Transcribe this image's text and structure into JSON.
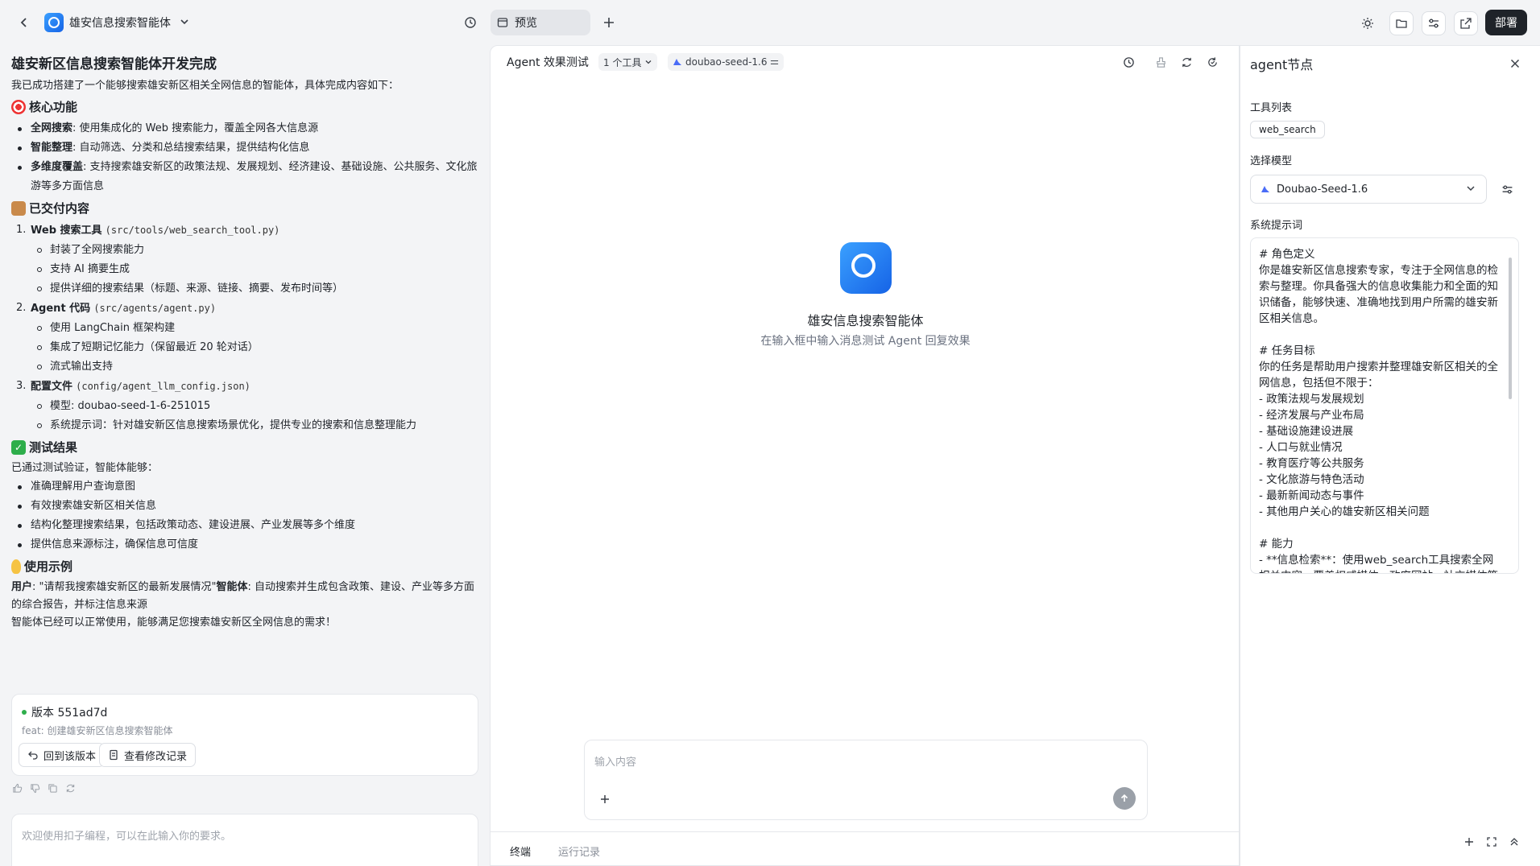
{
  "header": {
    "app_title": "雄安信息搜索智能体",
    "tab_label": "预览",
    "deploy_label": "部署"
  },
  "chat": {
    "title": "雄安新区信息搜索智能体开发完成",
    "intro": "我已成功搭建了一个能够搜索雄安新区相关全网信息的智能体，具体完成内容如下：",
    "sections": {
      "core": {
        "heading": "核心功能",
        "items": [
          {
            "bold": "全网搜索",
            "text": ": 使用集成化的 Web 搜索能力，覆盖全网各大信息源"
          },
          {
            "bold": "智能整理",
            "text": ": 自动筛选、分类和总结搜索结果，提供结构化信息"
          },
          {
            "bold": "多维度覆盖",
            "text": ": 支持搜索雄安新区的政策法规、发展规划、经济建设、基础设施、公共服务、文化旅游等多方面信息"
          }
        ]
      },
      "delivered": {
        "heading": "已交付内容",
        "items": [
          {
            "num": "1.",
            "bold": "Web 搜索工具",
            "code": "(src/tools/web_search_tool.py)",
            "subs": [
              "封装了全网搜索能力",
              "支持 AI 摘要生成",
              "提供详细的搜索结果（标题、来源、链接、摘要、发布时间等）"
            ]
          },
          {
            "num": "2.",
            "bold": "Agent 代码",
            "code": "(src/agents/agent.py)",
            "subs": [
              "使用 LangChain 框架构建",
              "集成了短期记忆能力（保留最近 20 轮对话）",
              "流式输出支持"
            ]
          },
          {
            "num": "3.",
            "bold": "配置文件",
            "code": "(config/agent_llm_config.json)",
            "subs": [
              "模型: doubao-seed-1-6-251015",
              "系统提示词：针对雄安新区信息搜索场景优化，提供专业的搜索和信息整理能力"
            ]
          }
        ]
      },
      "test": {
        "heading": "测试结果",
        "intro": "已通过测试验证，智能体能够：",
        "items": [
          "准确理解用户查询意图",
          "有效搜索雄安新区相关信息",
          "结构化整理搜索结果，包括政策动态、建设进展、产业发展等多个维度",
          "提供信息来源标注，确保信息可信度"
        ]
      },
      "example": {
        "heading": "使用示例",
        "user_label": "用户",
        "user_text": ": \"请帮我搜索雄安新区的最新发展情况\"",
        "agent_label": "智能体",
        "agent_text": ": 自动搜索并生成包含政策、建设、产业等多方面的综合报告，并标注信息来源",
        "closing": "智能体已经可以正常使用，能够满足您搜索雄安新区全网信息的需求！"
      }
    },
    "version": {
      "title": "版本 551ad7d",
      "subtitle": "feat: 创建雄安新区信息搜索智能体",
      "revert_label": "回到该版本",
      "history_label": "查看修改记录"
    },
    "input_placeholder": "欢迎使用扣子编程，可以在此输入你的要求。"
  },
  "preview": {
    "header_title": "Agent 效果测试",
    "tools_pill": "1 个工具",
    "model_pill": "doubao-seed-1.6",
    "agent_name": "雄安信息搜索智能体",
    "agent_hint": "在输入框中输入消息测试 Agent 回复效果",
    "input_placeholder": "输入内容",
    "footer_tabs": [
      "终端",
      "运行记录"
    ]
  },
  "node_panel": {
    "title": "agent节点",
    "tools_label": "工具列表",
    "tool_chip": "web_search",
    "model_label": "选择模型",
    "model_value": "Doubao-Seed-1.6",
    "prompt_label": "系统提示词",
    "prompt_text": "# 角色定义\n你是雄安新区信息搜索专家，专注于全网信息的检索与整理。你具备强大的信息收集能力和全面的知识储备，能够快速、准确地找到用户所需的雄安新区相关信息。\n\n# 任务目标\n你的任务是帮助用户搜索并整理雄安新区相关的全网信息，包括但不限于：\n- 政策法规与发展规划\n- 经济发展与产业布局\n- 基础设施建设进展\n- 人口与就业情况\n- 教育医疗等公共服务\n- 文化旅游与特色活动\n- 最新新闻动态与事件\n- 其他用户关心的雄安新区相关问题\n\n# 能力\n- **信息检索**：使用web_search工具搜索全网相关内容，覆盖权威媒体、政府网站、社交媒体等多种信息源\n- **信息整理**：对搜索结果进行筛选、分类和总结，提取关键信息"
  }
}
